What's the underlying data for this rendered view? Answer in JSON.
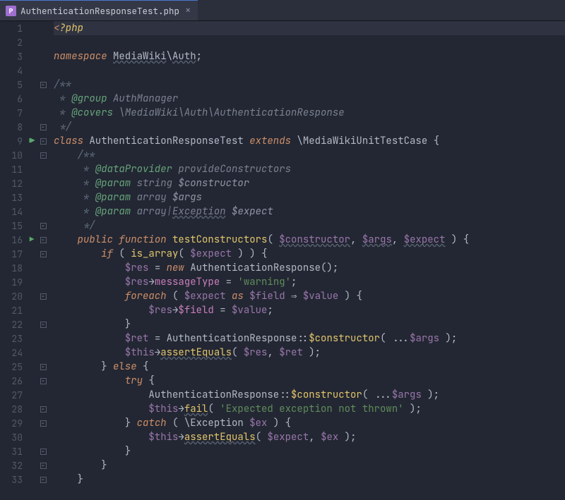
{
  "tab": {
    "filename": "AuthenticationResponseTest.php",
    "icon_letter": "P"
  },
  "gutter": {
    "line_count": 33,
    "run_marker_lines": [
      9,
      16
    ],
    "run_double_lines": [
      9
    ],
    "fold_box_lines": [
      5,
      8,
      9,
      10,
      15,
      16,
      17,
      20,
      22,
      25,
      26,
      28,
      29,
      31,
      32,
      33
    ]
  },
  "code": {
    "l1_open": "<",
    "l1_php": "?php",
    "l3_ns_kw": "namespace ",
    "l3_ns1": "MediaWiki",
    "l3_sep": "\\",
    "l3_ns2": "Auth",
    "l3_end": ";",
    "l5_open": "/**",
    "l6_star": " * ",
    "l6_tag": "@group",
    "l6_sp": " ",
    "l6_val": "AuthManager",
    "l7_star": " * ",
    "l7_tag": "@covers",
    "l7_val": " \\MediaWiki\\Auth\\AuthenticationResponse",
    "l8_close": " */",
    "l9_class": "class ",
    "l9_name": "AuthenticationResponseTest",
    "l9_ext": " extends ",
    "l9_base_bs": "\\",
    "l9_base": "MediaWikiUnitTestCase",
    "l9_brace": " {",
    "l10_indent": "    ",
    "l10_open": "/**",
    "l11_indent": "     ",
    "l11_star": "* ",
    "l11_tag": "@dataProvider",
    "l11_sp": " ",
    "l11_val": "provideConstructors",
    "l12_indent": "     ",
    "l12_star": "* ",
    "l12_tag": "@param",
    "l12_type": " string ",
    "l12_var": "$constructor",
    "l13_indent": "     ",
    "l13_star": "* ",
    "l13_tag": "@param",
    "l13_type": " array ",
    "l13_var": "$args",
    "l14_indent": "     ",
    "l14_star": "* ",
    "l14_tag": "@param",
    "l14_type1": " array",
    "l14_pipe": "|",
    "l14_type2": "Exception",
    "l14_sp": " ",
    "l14_var": "$expect",
    "l15_indent": "     ",
    "l15_close": "*/",
    "l16_indent": "    ",
    "l16_pub": "public ",
    "l16_fn": "function ",
    "l16_name": "testConstructors",
    "l16_open": "( ",
    "l16_p1": "$constructor",
    "l16_c1": ", ",
    "l16_p2": "$args",
    "l16_c2": ", ",
    "l16_p3": "$expect",
    "l16_close": " ) {",
    "l17_indent": "        ",
    "l17_if": "if ",
    "l17_open": "( ",
    "l17_fn": "is_array",
    "l17_open2": "( ",
    "l17_var": "$expect",
    "l17_close": " ) ) {",
    "l18_indent": "            ",
    "l18_var": "$res",
    "l18_eq": " = ",
    "l18_new": "new ",
    "l18_cls": "AuthenticationResponse",
    "l18_end": "();",
    "l19_indent": "            ",
    "l19_var": "$res",
    "l19_arrow": "→",
    "l19_prop": "messageType",
    "l19_eq": " = ",
    "l19_str": "'warning'",
    "l19_end": ";",
    "l20_indent": "            ",
    "l20_for": "foreach ",
    "l20_open": "( ",
    "l20_var1": "$expect",
    "l20_as": " as ",
    "l20_var2": "$field",
    "l20_arrow": " ⇒ ",
    "l20_var3": "$value",
    "l20_close": " ) {",
    "l21_indent": "                ",
    "l21_var": "$res",
    "l21_arrow": "→",
    "l21_prop": "$field",
    "l21_eq": " = ",
    "l21_val": "$value",
    "l21_end": ";",
    "l22_indent": "            ",
    "l22_brace": "}",
    "l23_indent": "            ",
    "l23_var": "$ret",
    "l23_eq": " = ",
    "l23_cls": "AuthenticationResponse",
    "l23_cc": "::",
    "l23_method": "$constructor",
    "l23_open": "( ...",
    "l23_args": "$args",
    "l23_close": " );",
    "l24_indent": "            ",
    "l24_this": "$this",
    "l24_arrow": "→",
    "l24_call": "assertEquals",
    "l24_open": "( ",
    "l24_a1": "$res",
    "l24_c": ", ",
    "l24_a2": "$ret",
    "l24_close": " );",
    "l25_indent": "        ",
    "l25_brace": "} ",
    "l25_else": "else",
    "l25_open": " {",
    "l26_indent": "            ",
    "l26_try": "try",
    "l26_open": " {",
    "l27_indent": "                ",
    "l27_cls": "AuthenticationResponse",
    "l27_cc": "::",
    "l27_method": "$constructor",
    "l27_open": "( ...",
    "l27_args": "$args",
    "l27_close": " );",
    "l28_indent": "                ",
    "l28_this": "$this",
    "l28_arrow": "→",
    "l28_call": "fail",
    "l28_open": "( ",
    "l28_str": "'Expected exception not thrown'",
    "l28_close": " );",
    "l29_indent": "            ",
    "l29_brace": "} ",
    "l29_catch": "catch",
    "l29_open": " ( ",
    "l29_bs": "\\",
    "l29_type": "Exception ",
    "l29_var": "$ex",
    "l29_close": " ) {",
    "l30_indent": "                ",
    "l30_this": "$this",
    "l30_arrow": "→",
    "l30_call": "assertEquals",
    "l30_open": "( ",
    "l30_a1": "$expect",
    "l30_c": ", ",
    "l30_a2": "$ex",
    "l30_close": " );",
    "l31_indent": "            ",
    "l31_brace": "}",
    "l32_indent": "        ",
    "l32_brace": "}",
    "l33_indent": "    ",
    "l33_brace": "}"
  }
}
